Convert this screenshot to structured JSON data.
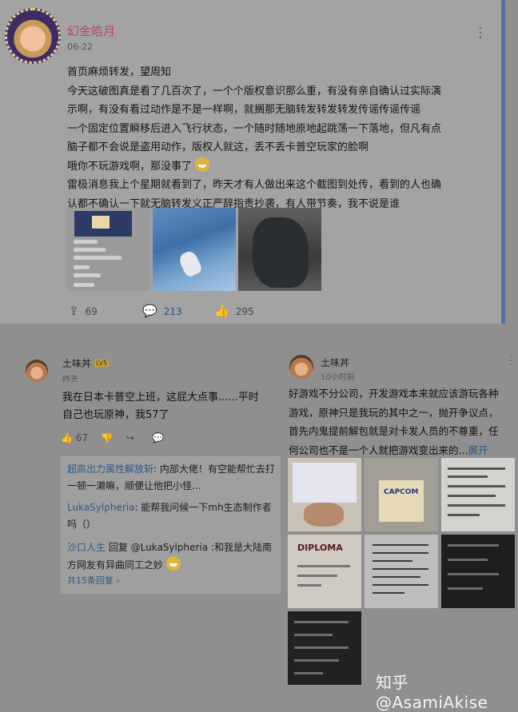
{
  "post": {
    "username": "幻金皓月",
    "date": "06-22",
    "lines": [
      "首页麻烦转发，望周知",
      "今天这破图真是看了几百次了，一个个版权意识那么重，有没有亲自确认过实际演",
      "示啊，有没有看过动作是不是一样啊，就搁那无脑转发转发转发传谣传谣传谣",
      "一个固定位置瞬移后进入飞行状态，一个随时随地原地起跳荡一下落地，但凡有点",
      "脑子都不会说是盗用动作，版权人就这，丢不丢卡普空玩家的脸啊",
      "哦你不玩游戏啊，那没事了",
      "雷极消息我上个星期就看到了，昨天才有人做出来这个截图到处传，看到的人也确",
      "认都不确认一下就无脑转发义正严辞指责抄袭，有人带节奏，我不说是谁"
    ],
    "emoji": "grin-emoji",
    "stats": {
      "repost": "69",
      "comment": "213",
      "like": "295"
    }
  },
  "comment_left": {
    "username": "土味丼",
    "level": "LV5",
    "time": "昨天",
    "text_lines": [
      "我在日本卡普空上班，这屁大点事......平时",
      "自己也玩原神，我57了"
    ],
    "likes": "67",
    "replies": [
      {
        "who": "超高出力属性解放斩",
        "text": ": 内部大佬！有空能帮忙去打一顿一濑嘛，顺便让他把小怪..."
      },
      {
        "who": "LukaSylpheria",
        "text": ": 能帮我问候一下mh生态制作者吗（）"
      },
      {
        "who": "沙口人生",
        "text": " 回复 @LukaSylpheria :和我是大陆南方网友有异曲同工之妙"
      }
    ],
    "more": "共15条回复"
  },
  "comment_right": {
    "username": "土味丼",
    "time": "10小时前",
    "text_lines": [
      "好游戏不分公司，开发游戏本来就应该游玩各种",
      "游戏，原神只是我玩的其中之一，抛开争议点，",
      "首先内鬼提前解包就是对卡发人员的不尊重，任",
      "何公司也不是一个人就把游戏变出来的..."
    ],
    "expand": "展开",
    "images": {
      "capcom": "CAPCOM",
      "diploma": "DIPLOMA"
    }
  },
  "watermark": "知乎 @AsamiAkise"
}
